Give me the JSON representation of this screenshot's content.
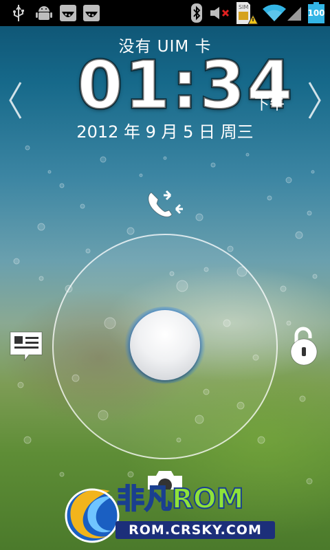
{
  "status_bar": {
    "left_icons": [
      "usb-icon",
      "android-debug-icon",
      "notification-icon",
      "notification-icon"
    ],
    "right_icons": [
      "bluetooth-icon",
      "speaker-muted-icon",
      "sim-warning-icon",
      "wifi-icon",
      "signal-icon",
      "battery-icon"
    ],
    "sim_label": "SIM",
    "battery_level": "100",
    "battery_color": "#33b5e5"
  },
  "lockscreen": {
    "carrier": "没有 UIM 卡",
    "time": "01:34",
    "ampm": "下午",
    "date": "2012 年 9 月 5 日 周三",
    "nav_icons": [
      "chevron-left-icon",
      "chevron-right-icon"
    ],
    "targets": {
      "top": "phone-missed-call-icon",
      "left": "message-icon",
      "right": "unlock-icon",
      "bottom": "camera-icon"
    },
    "knob_glow_color": "#3aa0ff"
  },
  "watermark": {
    "brand_cn": "非凡",
    "brand_rom": "ROM",
    "url": "ROM.CRSKY.COM"
  }
}
